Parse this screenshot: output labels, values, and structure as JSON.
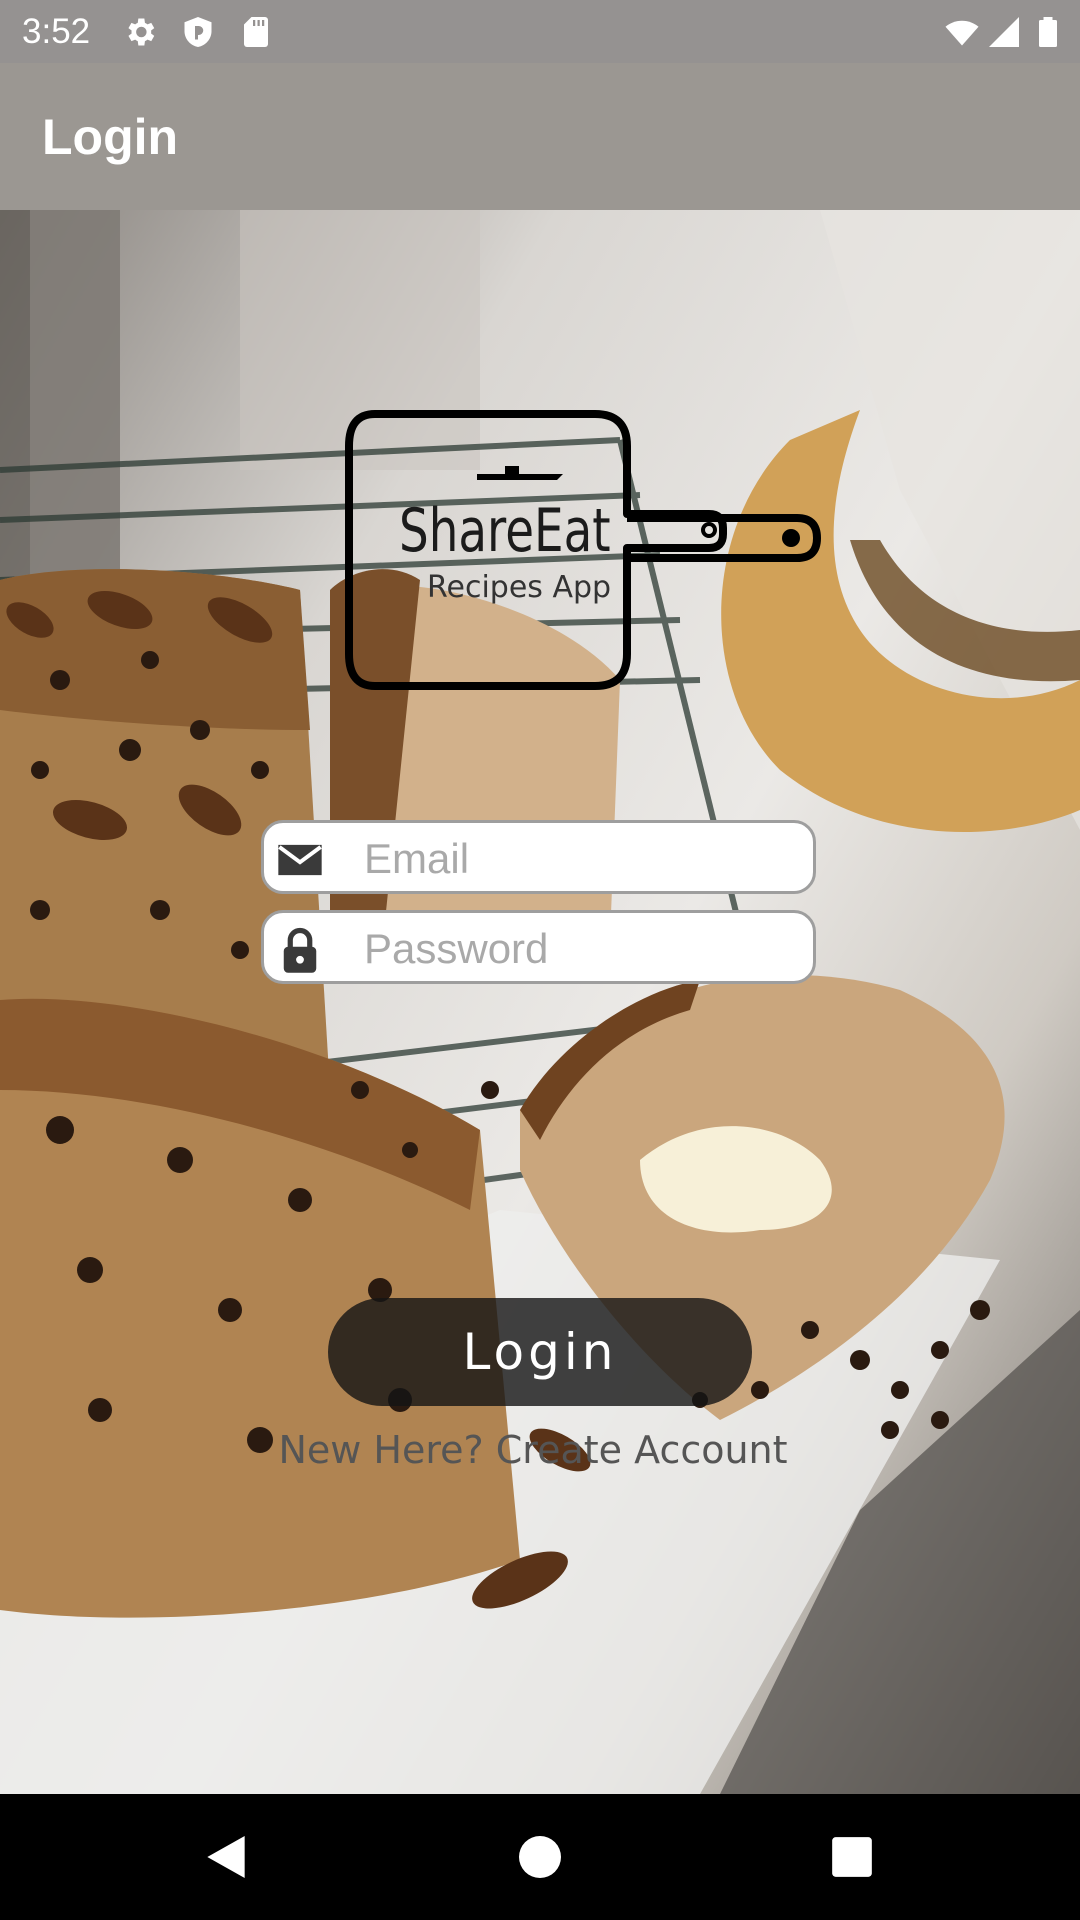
{
  "status_bar": {
    "time": "3:52",
    "left_icons": [
      "gear-icon",
      "shield-icon",
      "sd-card-icon"
    ],
    "right_icons": [
      "wifi-icon",
      "cellular-signal-icon",
      "battery-icon"
    ]
  },
  "app_bar": {
    "title": "Login"
  },
  "background_image": {
    "subject": "banana bread on a cooling rack"
  },
  "logo": {
    "name": "ShareEat",
    "tagline": "Recipes App"
  },
  "form": {
    "email": {
      "placeholder": "Email",
      "value": "",
      "icon": "mail-icon"
    },
    "password": {
      "placeholder": "Password",
      "value": "",
      "icon": "lock-icon"
    },
    "login_button_label": "Login",
    "signup_link_label": "New Here? Create Account"
  },
  "nav_bar": {
    "buttons": [
      "back-icon",
      "home-icon",
      "recents-icon"
    ]
  },
  "colors": {
    "status_bar": "#959291",
    "app_bar": "#9b9792",
    "button": "#141414",
    "nav_bar": "#000000"
  }
}
